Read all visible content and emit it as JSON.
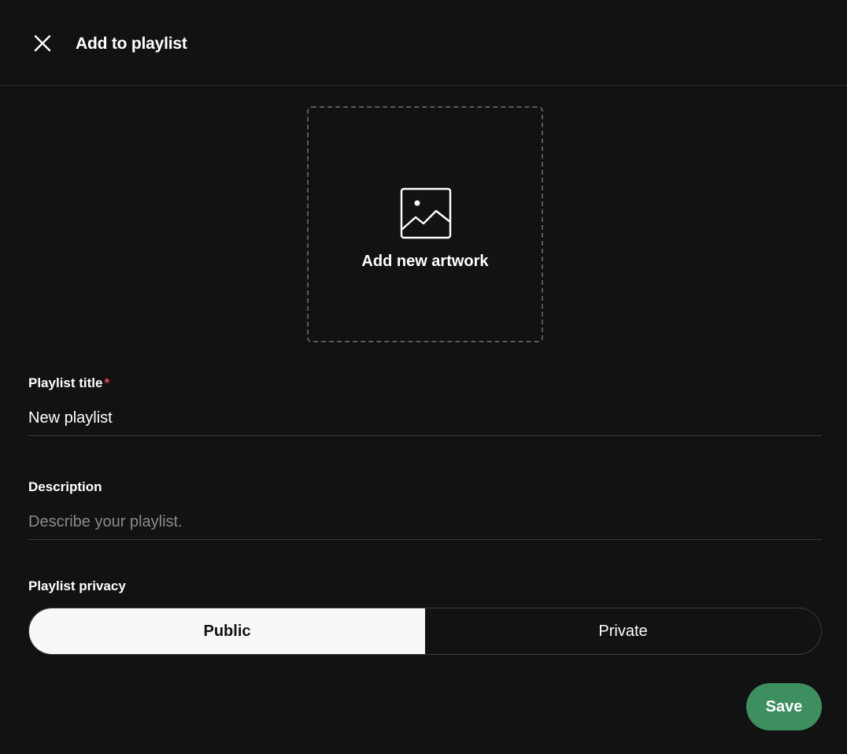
{
  "header": {
    "title": "Add to playlist",
    "close_icon": "close-icon"
  },
  "artwork": {
    "label": "Add new artwork",
    "icon": "image-icon"
  },
  "form": {
    "title_label": "Playlist title",
    "title_required_marker": "*",
    "title_value": "New playlist",
    "description_label": "Description",
    "description_placeholder": "Describe your playlist.",
    "description_value": "",
    "privacy_label": "Playlist privacy",
    "privacy_options": [
      "Public",
      "Private"
    ],
    "privacy_selected": "Public"
  },
  "actions": {
    "save_label": "Save"
  },
  "colors": {
    "background": "#121212",
    "accent_save": "#3d8f60",
    "required_star": "#e9485e",
    "toggle_selected_bg": "#f8f8f8"
  }
}
